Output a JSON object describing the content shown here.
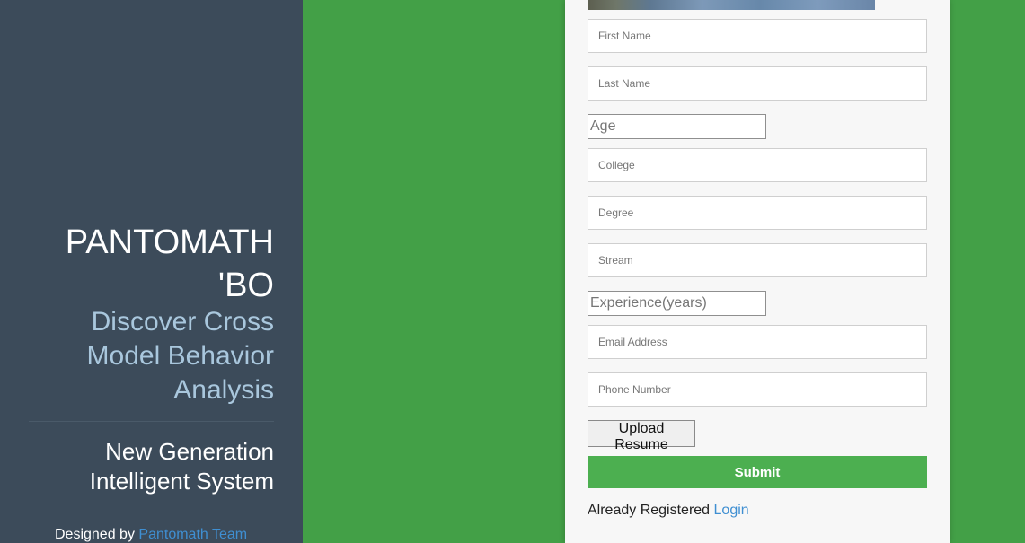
{
  "sidebar": {
    "title": "PANTOMATH 'BO",
    "subtitle": "Discover Cross Model Behavior Analysis",
    "tagline": "New Generation Intelligent System",
    "credit_prefix": "Designed by",
    "credit_link": "Pantomath Team"
  },
  "form": {
    "first_name_placeholder": "First Name",
    "last_name_placeholder": "Last Name",
    "age_placeholder": "Age",
    "college_placeholder": "College",
    "degree_placeholder": "Degree",
    "stream_placeholder": "Stream",
    "experience_placeholder": "Experience(years)",
    "email_placeholder": "Email Address",
    "phone_placeholder": "Phone Number",
    "upload_label": "Upload Resume",
    "submit_label": "Submit",
    "login_prefix": "Already Registered",
    "login_link": "Login"
  },
  "colors": {
    "background": "#43a047",
    "sidebar": "#3c4b5a",
    "accent_link": "#3f8fd2",
    "submit": "#4caf50"
  }
}
